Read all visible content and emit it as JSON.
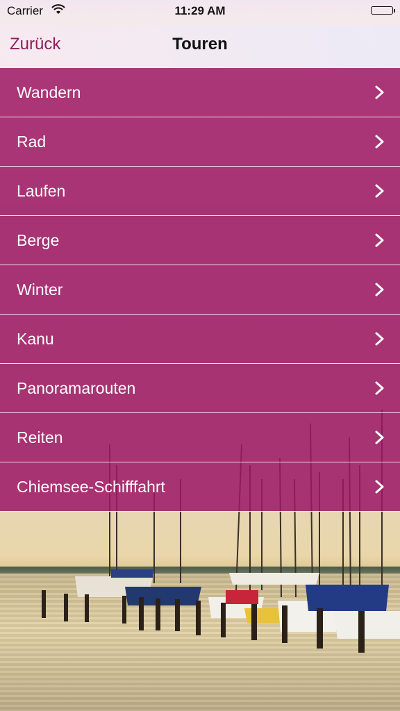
{
  "status": {
    "carrier": "Carrier",
    "time": "11:29 AM"
  },
  "nav": {
    "back_label": "Zurück",
    "title": "Touren"
  },
  "menu": {
    "items": [
      {
        "label": "Wandern"
      },
      {
        "label": "Rad"
      },
      {
        "label": "Laufen"
      },
      {
        "label": "Berge"
      },
      {
        "label": "Winter"
      },
      {
        "label": "Kanu"
      },
      {
        "label": "Panoramarouten"
      },
      {
        "label": "Reiten"
      },
      {
        "label": "Chiemsee-Schifffahrt"
      }
    ]
  },
  "colors": {
    "accent": "#8c1f5c",
    "row_overlay": "#9d1867"
  },
  "icons": {
    "wifi": "wifi-icon",
    "battery": "battery-icon",
    "chevron": "chevron-right-icon"
  }
}
